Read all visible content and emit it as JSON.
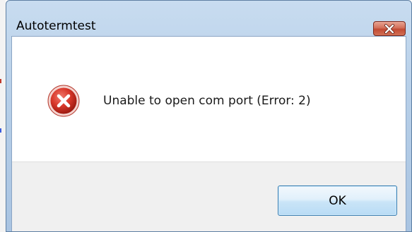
{
  "window": {
    "title": "Autotermtest",
    "close_icon": "close-icon"
  },
  "dialog": {
    "icon": "error-icon",
    "message": "Unable to open com port (Error: 2)",
    "ok_label": "OK"
  },
  "colors": {
    "error_red": "#d32f2f",
    "close_button": "#c24a33",
    "titlebar": "#b7cfe8",
    "button_area": "#f0f0f0"
  }
}
